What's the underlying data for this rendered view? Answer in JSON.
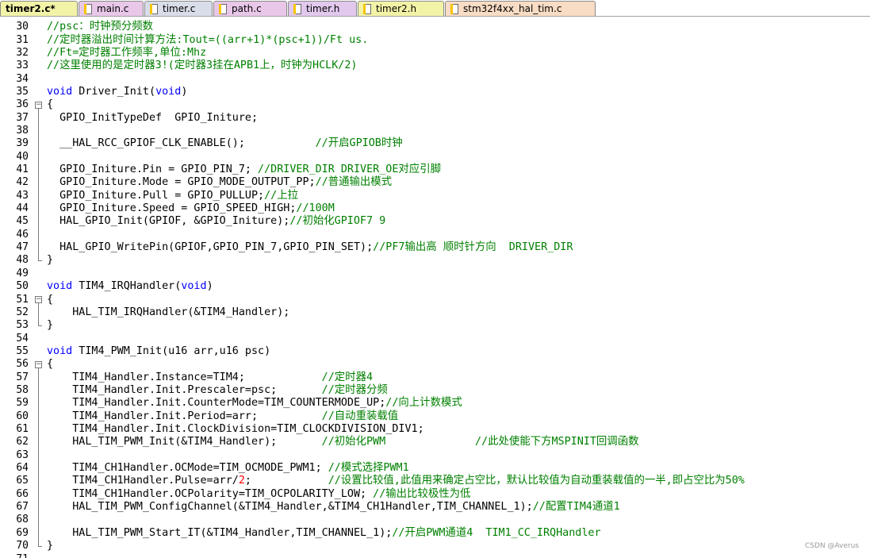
{
  "tabs": [
    {
      "label": "timer2.c*",
      "bg": "#f3f3a8",
      "active": true
    },
    {
      "label": "main.c",
      "bg": "#e8c7e8",
      "active": false
    },
    {
      "label": "timer.c",
      "bg": "#d9dde9",
      "active": false
    },
    {
      "label": "path.c",
      "bg": "#e8c7e8",
      "active": false
    },
    {
      "label": "timer.h",
      "bg": "#e1c8ec",
      "active": false
    },
    {
      "label": "timer2.h",
      "bg": "#f3f3a8",
      "active": false
    },
    {
      "label": "stm32f4xx_hal_tim.c",
      "bg": "#f8dcc4",
      "active": false
    }
  ],
  "colors": {
    "keyword": "#0000ff",
    "comment": "#008000",
    "number": "#ff0000",
    "text": "#000000"
  },
  "lines": [
    {
      "n": "30",
      "tokens": [
        {
          "t": "cm",
          "s": "//psc：时钟预分频数"
        }
      ]
    },
    {
      "n": "31",
      "tokens": [
        {
          "t": "cm",
          "s": "//定时器溢出时间计算方法:Tout=((arr+1)*(psc+1))/Ft us."
        }
      ]
    },
    {
      "n": "32",
      "tokens": [
        {
          "t": "cm",
          "s": "//Ft=定时器工作频率,单位:Mhz"
        }
      ]
    },
    {
      "n": "33",
      "tokens": [
        {
          "t": "cm",
          "s": "//这里使用的是定时器3!(定时器3挂在APB1上，时钟为HCLK/2)"
        }
      ]
    },
    {
      "n": "34",
      "tokens": []
    },
    {
      "n": "35",
      "tokens": [
        {
          "t": "kw",
          "s": "void"
        },
        {
          "t": "",
          "s": " Driver_Init("
        },
        {
          "t": "kw",
          "s": "void"
        },
        {
          "t": "",
          "s": ")"
        }
      ]
    },
    {
      "n": "36",
      "fold": "open",
      "tokens": [
        {
          "t": "",
          "s": "{"
        }
      ]
    },
    {
      "n": "37",
      "tokens": [
        {
          "t": "",
          "s": "  GPIO_InitTypeDef  GPIO_Initure;"
        }
      ]
    },
    {
      "n": "38",
      "tokens": []
    },
    {
      "n": "39",
      "tokens": [
        {
          "t": "",
          "s": "  __HAL_RCC_GPIOF_CLK_ENABLE();           "
        },
        {
          "t": "cm",
          "s": "//开启GPIOB时钟"
        }
      ]
    },
    {
      "n": "40",
      "tokens": []
    },
    {
      "n": "41",
      "tokens": [
        {
          "t": "",
          "s": "  GPIO_Initure.Pin = GPIO_PIN_7; "
        },
        {
          "t": "cm",
          "s": "//DRIVER_DIR DRIVER_OE对应引脚"
        }
      ]
    },
    {
      "n": "42",
      "tokens": [
        {
          "t": "",
          "s": "  GPIO_Initure.Mode = GPIO_MODE_OUTPUT_PP;"
        },
        {
          "t": "cm",
          "s": "//普通输出模式"
        }
      ]
    },
    {
      "n": "43",
      "tokens": [
        {
          "t": "",
          "s": "  GPIO_Initure.Pull = GPIO_PULLUP;"
        },
        {
          "t": "cm",
          "s": "//上拉"
        }
      ]
    },
    {
      "n": "44",
      "tokens": [
        {
          "t": "",
          "s": "  GPIO_Initure.Speed = GPIO_SPEED_HIGH;"
        },
        {
          "t": "cm",
          "s": "//100M"
        }
      ]
    },
    {
      "n": "45",
      "tokens": [
        {
          "t": "",
          "s": "  HAL_GPIO_Init(GPIOF, &GPIO_Initure);"
        },
        {
          "t": "cm",
          "s": "//初始化GPIOF7 9"
        }
      ]
    },
    {
      "n": "46",
      "tokens": []
    },
    {
      "n": "47",
      "tokens": [
        {
          "t": "",
          "s": "  HAL_GPIO_WritePin(GPIOF,GPIO_PIN_7,GPIO_PIN_SET);"
        },
        {
          "t": "cm",
          "s": "//PF7输出高 顺时针方向  DRIVER_DIR"
        }
      ]
    },
    {
      "n": "48",
      "fold": "end",
      "tokens": [
        {
          "t": "",
          "s": "}"
        }
      ]
    },
    {
      "n": "49",
      "tokens": []
    },
    {
      "n": "50",
      "tokens": [
        {
          "t": "kw",
          "s": "void"
        },
        {
          "t": "",
          "s": " TIM4_IRQHandler("
        },
        {
          "t": "kw",
          "s": "void"
        },
        {
          "t": "",
          "s": ")"
        }
      ]
    },
    {
      "n": "51",
      "fold": "open",
      "tokens": [
        {
          "t": "",
          "s": "{"
        }
      ]
    },
    {
      "n": "52",
      "tokens": [
        {
          "t": "",
          "s": "    HAL_TIM_IRQHandler(&TIM4_Handler);"
        }
      ]
    },
    {
      "n": "53",
      "fold": "end",
      "tokens": [
        {
          "t": "",
          "s": "}"
        }
      ]
    },
    {
      "n": "54",
      "tokens": []
    },
    {
      "n": "55",
      "tokens": [
        {
          "t": "kw",
          "s": "void"
        },
        {
          "t": "",
          "s": " TIM4_PWM_Init(u16 arr,u16 psc)"
        }
      ]
    },
    {
      "n": "56",
      "fold": "open",
      "tokens": [
        {
          "t": "",
          "s": "{"
        }
      ]
    },
    {
      "n": "57",
      "tokens": [
        {
          "t": "",
          "s": "    TIM4_Handler.Instance=TIM4;            "
        },
        {
          "t": "cm",
          "s": "//定时器4"
        }
      ]
    },
    {
      "n": "58",
      "tokens": [
        {
          "t": "",
          "s": "    TIM4_Handler.Init.Prescaler=psc;       "
        },
        {
          "t": "cm",
          "s": "//定时器分频"
        }
      ]
    },
    {
      "n": "59",
      "tokens": [
        {
          "t": "",
          "s": "    TIM4_Handler.Init.CounterMode=TIM_COUNTERMODE_UP;"
        },
        {
          "t": "cm",
          "s": "//向上计数模式"
        }
      ]
    },
    {
      "n": "60",
      "tokens": [
        {
          "t": "",
          "s": "    TIM4_Handler.Init.Period=arr;          "
        },
        {
          "t": "cm",
          "s": "//自动重装载值"
        }
      ]
    },
    {
      "n": "61",
      "tokens": [
        {
          "t": "",
          "s": "    TIM4_Handler.Init.ClockDivision=TIM_CLOCKDIVISION_DIV1;"
        }
      ]
    },
    {
      "n": "62",
      "tokens": [
        {
          "t": "",
          "s": "    HAL_TIM_PWM_Init(&TIM4_Handler);       "
        },
        {
          "t": "cm",
          "s": "//初始化PWM              //此处使能下方MSPINIT回调函数"
        }
      ]
    },
    {
      "n": "63",
      "tokens": []
    },
    {
      "n": "64",
      "tokens": [
        {
          "t": "",
          "s": "    TIM4_CH1Handler.OCMode=TIM_OCMODE_PWM1; "
        },
        {
          "t": "cm",
          "s": "//模式选择PWM1"
        }
      ]
    },
    {
      "n": "65",
      "tokens": [
        {
          "t": "",
          "s": "    TIM4_CH1Handler.Pulse=arr/"
        },
        {
          "t": "num",
          "s": "2"
        },
        {
          "t": "",
          "s": ";            "
        },
        {
          "t": "cm",
          "s": "//设置比较值,此值用来确定占空比，默认比较值为自动重装载值的一半,即占空比为50%"
        }
      ]
    },
    {
      "n": "66",
      "tokens": [
        {
          "t": "",
          "s": "    TIM4_CH1Handler.OCPolarity=TIM_OCPOLARITY_LOW; "
        },
        {
          "t": "cm",
          "s": "//输出比较极性为低"
        }
      ]
    },
    {
      "n": "67",
      "tokens": [
        {
          "t": "",
          "s": "    HAL_TIM_PWM_ConfigChannel(&TIM4_Handler,&TIM4_CH1Handler,TIM_CHANNEL_1);"
        },
        {
          "t": "cm",
          "s": "//配置TIM4通道1"
        }
      ]
    },
    {
      "n": "68",
      "tokens": []
    },
    {
      "n": "69",
      "tokens": [
        {
          "t": "",
          "s": "    HAL_TIM_PWM_Start_IT(&TIM4_Handler,TIM_CHANNEL_1);"
        },
        {
          "t": "cm",
          "s": "//开启PWM通道4  TIM1_CC_IRQHandler"
        }
      ]
    },
    {
      "n": "70",
      "fold": "end",
      "tokens": [
        {
          "t": "",
          "s": "}"
        }
      ]
    },
    {
      "n": "71",
      "tokens": []
    }
  ],
  "watermark": "CSDN @Averus"
}
